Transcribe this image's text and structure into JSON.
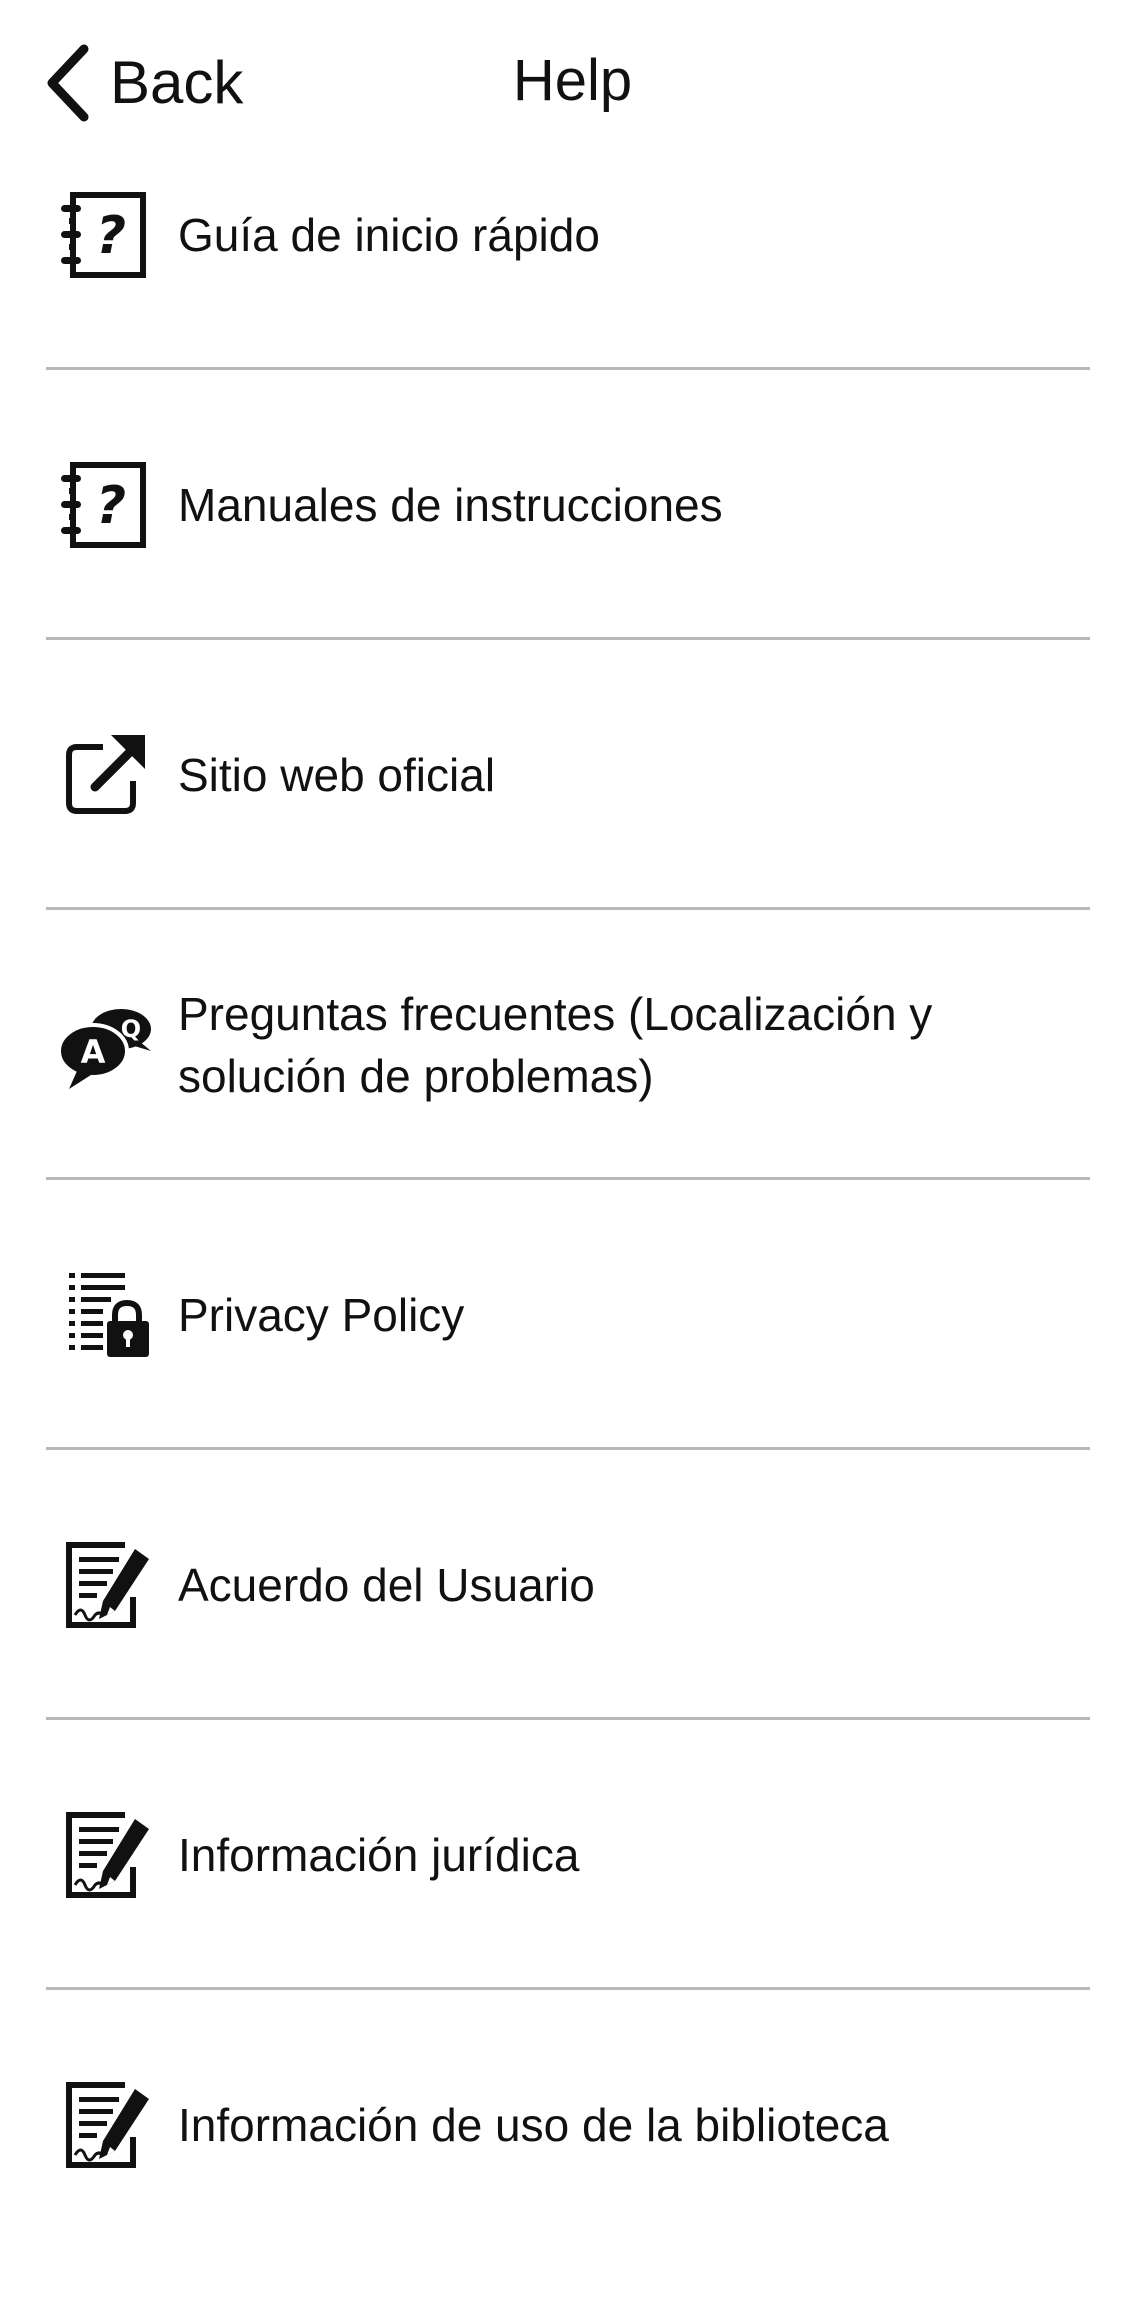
{
  "header": {
    "back_label": "Back",
    "title": "Help"
  },
  "items": [
    {
      "label": "Guía de inicio rápido",
      "icon": "manual-question-icon"
    },
    {
      "label": "Manuales de instrucciones",
      "icon": "manual-question-icon"
    },
    {
      "label": "Sitio web oficial",
      "icon": "external-link-icon"
    },
    {
      "label": "Preguntas frecuentes (Localización y solución de problemas)",
      "icon": "faq-qa-icon"
    },
    {
      "label": "Privacy Policy",
      "icon": "document-lock-icon"
    },
    {
      "label": "Acuerdo del Usuario",
      "icon": "signed-document-icon"
    },
    {
      "label": "Información jurídica",
      "icon": "signed-document-icon"
    },
    {
      "label": "Información de uso de la biblioteca",
      "icon": "signed-document-icon"
    }
  ],
  "colors": {
    "background": "#ffffff",
    "text": "#111111",
    "divider": "#b8b8b8"
  }
}
